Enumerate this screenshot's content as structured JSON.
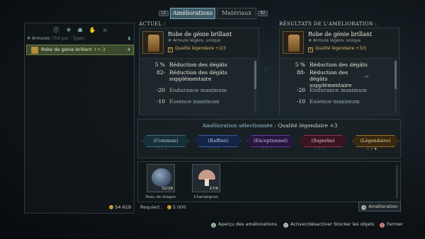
{
  "tabs": {
    "left_key": "L2",
    "right_key": "R2",
    "upgrades": "Améliorations",
    "materials": "Matériaux"
  },
  "inventory": {
    "category_icons": [
      "helmet-icon",
      "chest-icon",
      "mask-icon",
      "gauntlet-icon",
      "sword-icon"
    ],
    "category": "Armures",
    "sort_label": "(Trié par : Type)",
    "item": {
      "name": "Robe de génie brillant",
      "upgrade_arrows": "++",
      "level": "3",
      "count": "4"
    },
    "gold": "54 619"
  },
  "current": {
    "header": "ACTUEL :",
    "title": "Robe de génie brillant",
    "subtitle": "Armure légère, unique",
    "quality": "Qualité légendaire +2/3",
    "stats": [
      {
        "value": "5 %",
        "label": "Réduction des dégâts"
      },
      {
        "value": "82",
        "sup": "*",
        "label": "Réduction des dégâts supplémentaire"
      },
      {
        "value": "-20",
        "label": "Endurance maximum"
      },
      {
        "value": "-10",
        "label": "Essence maximum"
      }
    ]
  },
  "result": {
    "header": "RÉSULTATS DE L'AMÉLIORATION :",
    "title": "Robe de génie brillant",
    "subtitle": "Armure légère, unique",
    "quality": "Qualité légendaire +3/3",
    "stats": [
      {
        "value": "5 %",
        "label": "Réduction des dégâts"
      },
      {
        "value": "88",
        "sup": "*",
        "label": "Réduction des dégâts supplémentaire",
        "bonus": "+6"
      },
      {
        "value": "-20",
        "label": "Endurance maximum"
      },
      {
        "value": "-10",
        "label": "Essence maximum"
      }
    ]
  },
  "upgrade": {
    "header_prefix": "Amélioration sélectionnée :",
    "header_value": "Qualité légendaire +3",
    "tiers": [
      "(Commun)",
      "(Raffiné)",
      "(Exceptionnel)",
      "(Superbe)",
      "(Légendaire)"
    ]
  },
  "materials": [
    {
      "name": "Peau de dragon",
      "count": "32/28"
    },
    {
      "name": "Champignon",
      "count": "17/6"
    }
  ],
  "cost": {
    "label": "Requiert :",
    "amount": "5 000"
  },
  "actions": {
    "upgrade": "Amélioration",
    "preview": "Aperçu des améliorations",
    "toggle_store": "Activer/désactiver Stocker les objets",
    "close": "Fermer"
  },
  "colors": {
    "accent": "#7fa7b0",
    "legendary": "#e8c15a",
    "common": "#3e6f7a",
    "refined": "#3a5aa0",
    "exceptional": "#6a3aa0",
    "superb": "#9a2f4a",
    "legend_tier": "#9a6a2a"
  }
}
